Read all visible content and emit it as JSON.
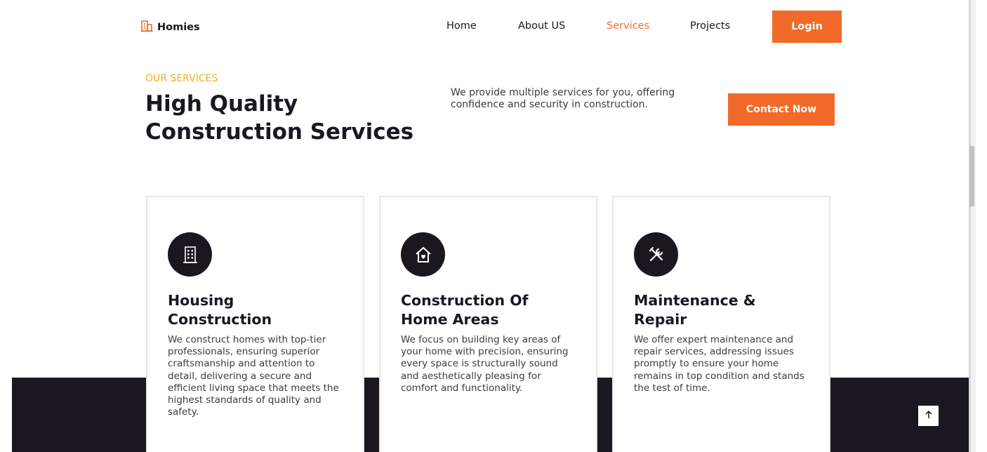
{
  "brand": {
    "name": "Homies",
    "icon": "building-icon",
    "accent": "#f26a2a",
    "eyebrow_color": "#f2b01e",
    "dark": "#1b1721"
  },
  "nav": {
    "items": [
      {
        "label": "Home"
      },
      {
        "label": "About US"
      },
      {
        "label": "Services",
        "active": true
      },
      {
        "label": "Projects"
      }
    ],
    "login_label": "Login"
  },
  "hero": {
    "eyebrow": "OUR SERVICES",
    "title_line1": "High Quality",
    "title_line2": "Construction Services",
    "description": "We provide multiple services for you, offering confidence and security in construction.",
    "cta_label": "Contact Now"
  },
  "services": [
    {
      "icon": "apartment-building-icon",
      "title_line1": "Housing",
      "title_line2": "Construction",
      "description": "We construct homes with top-tier professionals, ensuring superior craftsmanship and attention to detail, delivering a secure and efficient living space that meets the highest standards of quality and safety."
    },
    {
      "icon": "home-heart-icon",
      "title_line1": "Construction Of",
      "title_line2": "Home Areas",
      "description": "We focus on building key areas of your home with precision, ensuring every space is structurally sound and aesthetically pleasing for comfort and functionality."
    },
    {
      "icon": "tools-icon",
      "title_line1": "Maintenance &",
      "title_line2": "Repair",
      "description": "We offer expert maintenance and repair services, addressing issues promptly to ensure your home remains in top condition and stands the test of time."
    }
  ],
  "back_to_top": {
    "icon": "arrow-up-icon"
  }
}
